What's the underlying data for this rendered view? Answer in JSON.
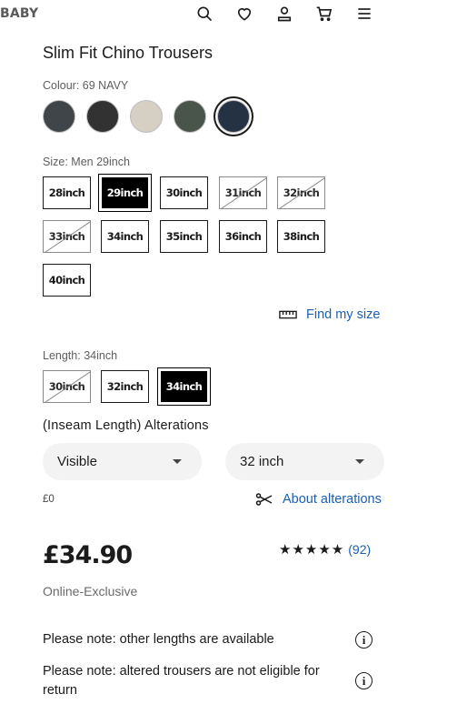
{
  "header": {
    "brand": "BABY",
    "icons": [
      "search-icon",
      "heart-icon",
      "account-icon",
      "cart-icon",
      "menu-icon"
    ]
  },
  "product": {
    "title": "Slim Fit Chino Trousers"
  },
  "colour": {
    "label": "Colour:",
    "selected": "69 NAVY",
    "swatches": [
      {
        "name": "dark-grey",
        "color": "#3f4548"
      },
      {
        "name": "charcoal",
        "color": "#323232"
      },
      {
        "name": "beige",
        "color": "#d6cfc3"
      },
      {
        "name": "olive",
        "color": "#49544a"
      },
      {
        "name": "navy",
        "color": "#253244"
      }
    ]
  },
  "size": {
    "label": "Size:",
    "selected": "Men 29inch",
    "options": [
      {
        "label": "28inch",
        "state": "available"
      },
      {
        "label": "29inch",
        "state": "selected"
      },
      {
        "label": "30inch",
        "state": "available"
      },
      {
        "label": "31inch",
        "state": "unavailable"
      },
      {
        "label": "32inch",
        "state": "unavailable"
      },
      {
        "label": "33inch",
        "state": "unavailable"
      },
      {
        "label": "34inch",
        "state": "available"
      },
      {
        "label": "35inch",
        "state": "available"
      },
      {
        "label": "36inch",
        "state": "available"
      },
      {
        "label": "38inch",
        "state": "available"
      },
      {
        "label": "40inch",
        "state": "available"
      }
    ],
    "find_my_size": "Find my size"
  },
  "length": {
    "label": "Length:",
    "selected": "34inch",
    "options": [
      {
        "label": "30inch",
        "state": "unavailable"
      },
      {
        "label": "32inch",
        "state": "available"
      },
      {
        "label": "34inch",
        "state": "selected"
      }
    ]
  },
  "alterations": {
    "title": "(Inseam Length) Alterations",
    "visibility_value": "Visible",
    "length_value": "32 inch",
    "fee": "£0",
    "about_link": "About alterations"
  },
  "pricing": {
    "price": "£34.90",
    "availability": "Online-Exclusive",
    "rating_stars": "★★★★★",
    "rating_value": 4.5,
    "review_count": "(92)"
  },
  "notes": [
    "Please note: other lengths are available",
    "Please note: altered trousers are not eligible for return"
  ],
  "colors": {
    "link": "#1a5fb4",
    "selected": "#000000"
  }
}
